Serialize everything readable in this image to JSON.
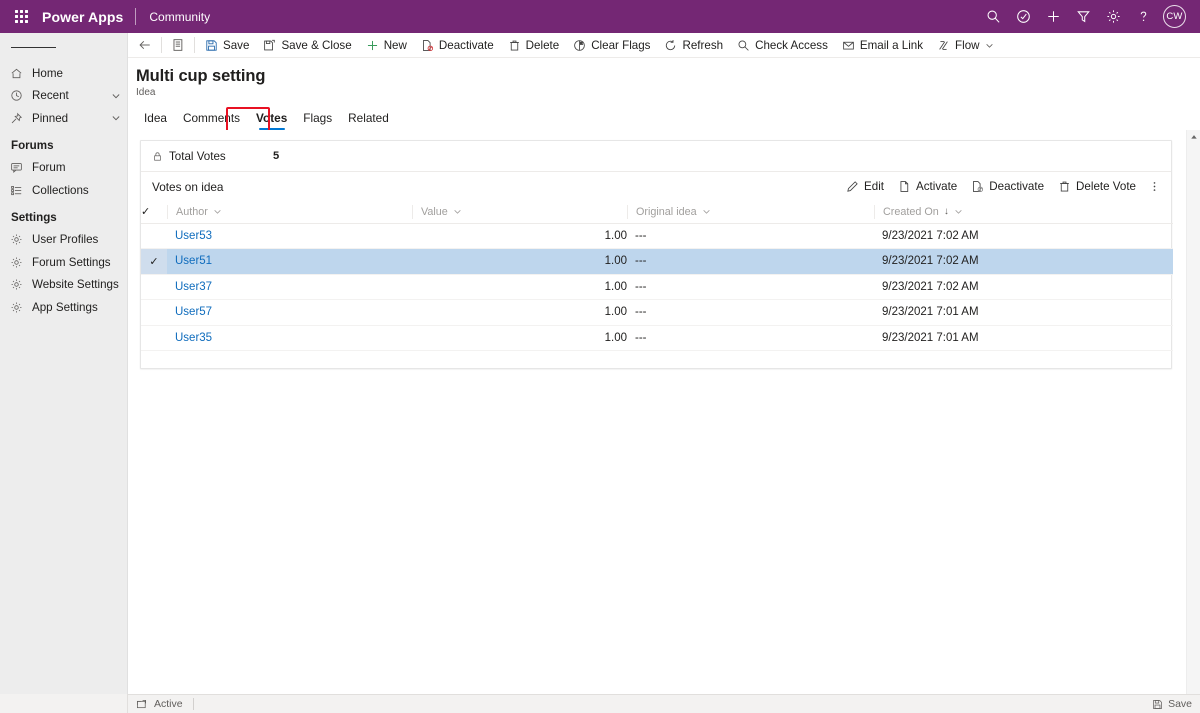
{
  "header": {
    "waffle_label": "app-launcher",
    "brand": "Power Apps",
    "app_name": "Community",
    "actions": [
      {
        "name": "search-icon",
        "label": "Search"
      },
      {
        "name": "assistant-icon",
        "label": "Assistant"
      },
      {
        "name": "plus-icon",
        "label": "Quick create"
      },
      {
        "name": "filter-icon",
        "label": "Filter"
      },
      {
        "name": "gear-icon",
        "label": "Settings"
      },
      {
        "name": "help-icon",
        "label": "Help"
      }
    ],
    "avatar_initials": "CW"
  },
  "sidebar": {
    "hamburger_label": "Expand navigation",
    "items": [
      {
        "label": "Home",
        "icon": "home-icon",
        "chevron": false
      },
      {
        "label": "Recent",
        "icon": "clock-icon",
        "chevron": true
      },
      {
        "label": "Pinned",
        "icon": "pin-icon",
        "chevron": true
      }
    ],
    "groups": [
      {
        "title": "Forums",
        "items": [
          {
            "label": "Forum",
            "icon": "forum-icon"
          },
          {
            "label": "Collections",
            "icon": "list-icon"
          }
        ]
      },
      {
        "title": "Settings",
        "items": [
          {
            "label": "User Profiles",
            "icon": "gear-icon"
          },
          {
            "label": "Forum Settings",
            "icon": "gear-icon"
          },
          {
            "label": "Website Settings",
            "icon": "gear-icon"
          },
          {
            "label": "App Settings",
            "icon": "gear-icon"
          }
        ]
      }
    ]
  },
  "commandbar": {
    "back_label": "Back",
    "form_selector_label": "Form selector",
    "buttons": [
      {
        "label": "Save",
        "icon": "save-icon"
      },
      {
        "label": "Save & Close",
        "icon": "save-close-icon"
      },
      {
        "label": "New",
        "icon": "plus-icon"
      },
      {
        "label": "Deactivate",
        "icon": "deactivate-icon"
      },
      {
        "label": "Delete",
        "icon": "trash-icon"
      },
      {
        "label": "Clear Flags",
        "icon": "clear-flags-icon"
      },
      {
        "label": "Refresh",
        "icon": "refresh-icon"
      },
      {
        "label": "Check Access",
        "icon": "check-access-icon"
      },
      {
        "label": "Email a Link",
        "icon": "email-link-icon"
      },
      {
        "label": "Flow",
        "icon": "flow-icon",
        "caret": true
      }
    ]
  },
  "record": {
    "title": "Multi cup setting",
    "subtitle": "Idea"
  },
  "tabs": [
    {
      "label": "Idea",
      "selected": false
    },
    {
      "label": "Comments",
      "selected": false
    },
    {
      "label": "Votes",
      "selected": true,
      "annotated": true
    },
    {
      "label": "Flags",
      "selected": false
    },
    {
      "label": "Related",
      "selected": false
    }
  ],
  "total_votes": {
    "label": "Total Votes",
    "value": "5",
    "lock_icon": "lock-icon"
  },
  "subgrid": {
    "title": "Votes on idea",
    "commands": [
      {
        "label": "Edit",
        "icon": "edit-pencil-icon"
      },
      {
        "label": "Activate",
        "icon": "activate-icon"
      },
      {
        "label": "Deactivate",
        "icon": "deactivate-icon"
      },
      {
        "label": "Delete Vote",
        "icon": "trash-icon"
      }
    ],
    "overflow_label": "More commands",
    "columns": [
      {
        "label": "Author",
        "sorted": false
      },
      {
        "label": "Value",
        "sorted": false
      },
      {
        "label": "Original idea",
        "sorted": false
      },
      {
        "label": "Created On",
        "sorted": true,
        "sort_direction": "desc"
      }
    ],
    "rows": [
      {
        "author": "User53",
        "value": "1.00",
        "original_idea": "---",
        "created_on": "9/23/2021 7:02 AM",
        "selected": false
      },
      {
        "author": "User51",
        "value": "1.00",
        "original_idea": "---",
        "created_on": "9/23/2021 7:02 AM",
        "selected": true
      },
      {
        "author": "User37",
        "value": "1.00",
        "original_idea": "---",
        "created_on": "9/23/2021 7:02 AM",
        "selected": false
      },
      {
        "author": "User57",
        "value": "1.00",
        "original_idea": "---",
        "created_on": "9/23/2021 7:01 AM",
        "selected": false
      },
      {
        "author": "User35",
        "value": "1.00",
        "original_idea": "---",
        "created_on": "9/23/2021 7:01 AM",
        "selected": false
      }
    ]
  },
  "statusbar": {
    "state_icon": "record-state-icon",
    "state": "Active",
    "save_label": "Save",
    "save_icon": "save-icon"
  },
  "colors": {
    "brand_purple": "#742774",
    "link_blue": "#0f6cbd",
    "tab_underline": "#0078d4",
    "row_selected": "#bed6ed",
    "annotation_red": "#e81123",
    "sidebar_bg": "#ededed"
  }
}
